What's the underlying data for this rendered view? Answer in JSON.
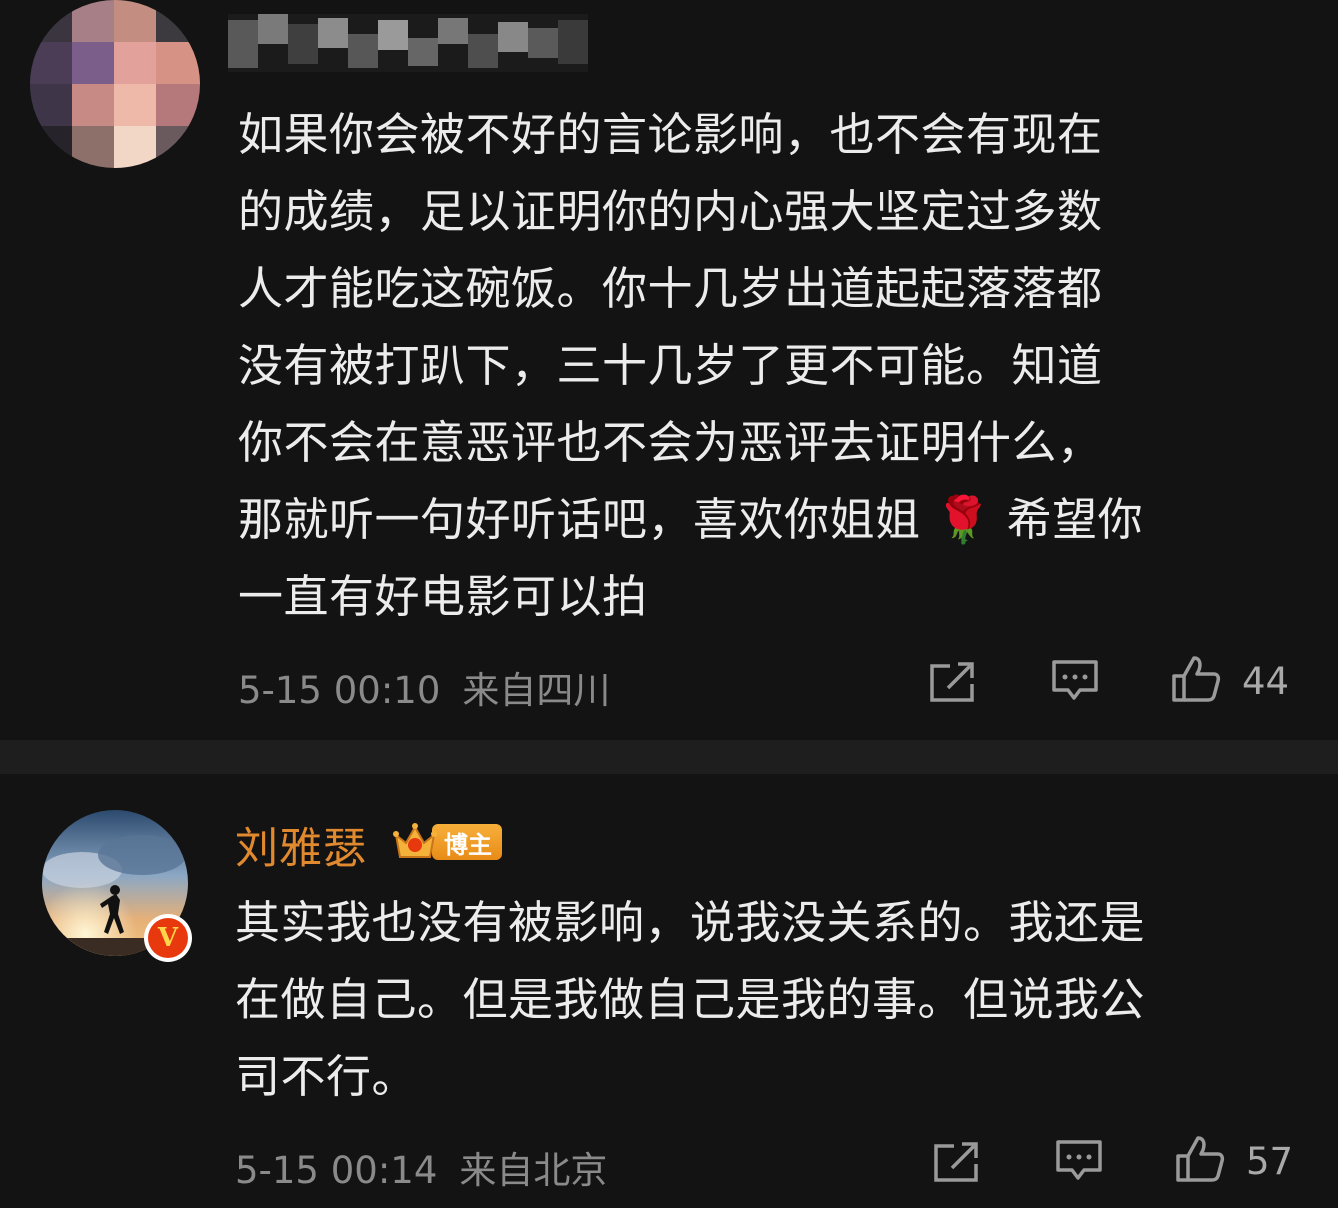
{
  "comments": [
    {
      "username": "",
      "body": "如果你会被不好的言论影响，也不会有现在\n的成绩，足以证明你的内心强大坚定过多数\n人才能吃这碗饭。你十几岁出道起起落落都\n没有被打趴下，三十几岁了更不可能。知道\n你不会在意恶评也不会为恶评去证明什么，\n那就听一句好听话吧，喜欢你姐姐 🌹 希望你\n一直有好电影可以拍",
      "time": "5-15 00:10",
      "location": "来自四川",
      "likes": "44",
      "icons": {
        "share": "share-icon",
        "reply": "comment-icon",
        "like": "thumbs-up-icon"
      }
    },
    {
      "username": "刘雅瑟",
      "badge_label": "博主",
      "verified_label": "V",
      "body": "其实我也没有被影响，说我没关系的。我还是\n在做自己。但是我做自己是我的事。但说我公\n司不行。",
      "time": "5-15 00:14",
      "location": "来自北京",
      "likes": "57",
      "icons": {
        "share": "share-icon",
        "reply": "comment-icon",
        "like": "thumbs-up-icon"
      }
    }
  ],
  "colors": {
    "background": "#131313",
    "divider": "#1e1e1e",
    "username": "#e0892e",
    "meta": "#8a8a8a",
    "verified": "#e8380d"
  }
}
